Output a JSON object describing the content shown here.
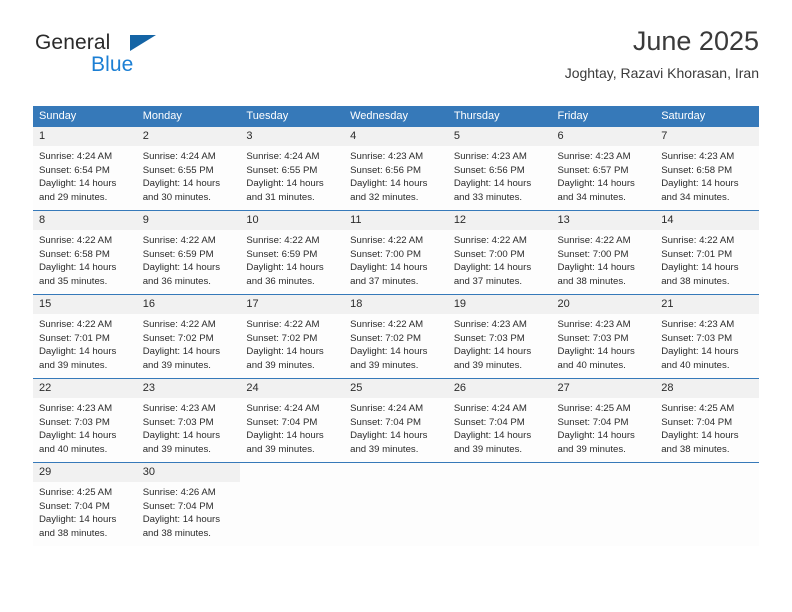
{
  "brand": {
    "word_one": "General",
    "word_two": "Blue",
    "triangle_icon": "brand-triangle-icon"
  },
  "header": {
    "title": "June 2025",
    "subtitle": "Joghtay, Razavi Khorasan, Iran"
  },
  "colors": {
    "header_blue": "#3679b9",
    "brand_blue": "#1c7fd4",
    "triangle_blue": "#1464a5",
    "daynum_band": "#f1f1f1",
    "text": "#2b2b2b"
  },
  "calendar": {
    "weekday_headers": [
      "Sunday",
      "Monday",
      "Tuesday",
      "Wednesday",
      "Thursday",
      "Friday",
      "Saturday"
    ],
    "weeks": [
      [
        {
          "day": "1",
          "sunrise": "Sunrise: 4:24 AM",
          "sunset": "Sunset: 6:54 PM",
          "daylight": "Daylight: 14 hours and 29 minutes."
        },
        {
          "day": "2",
          "sunrise": "Sunrise: 4:24 AM",
          "sunset": "Sunset: 6:55 PM",
          "daylight": "Daylight: 14 hours and 30 minutes."
        },
        {
          "day": "3",
          "sunrise": "Sunrise: 4:24 AM",
          "sunset": "Sunset: 6:55 PM",
          "daylight": "Daylight: 14 hours and 31 minutes."
        },
        {
          "day": "4",
          "sunrise": "Sunrise: 4:23 AM",
          "sunset": "Sunset: 6:56 PM",
          "daylight": "Daylight: 14 hours and 32 minutes."
        },
        {
          "day": "5",
          "sunrise": "Sunrise: 4:23 AM",
          "sunset": "Sunset: 6:56 PM",
          "daylight": "Daylight: 14 hours and 33 minutes."
        },
        {
          "day": "6",
          "sunrise": "Sunrise: 4:23 AM",
          "sunset": "Sunset: 6:57 PM",
          "daylight": "Daylight: 14 hours and 34 minutes."
        },
        {
          "day": "7",
          "sunrise": "Sunrise: 4:23 AM",
          "sunset": "Sunset: 6:58 PM",
          "daylight": "Daylight: 14 hours and 34 minutes."
        }
      ],
      [
        {
          "day": "8",
          "sunrise": "Sunrise: 4:22 AM",
          "sunset": "Sunset: 6:58 PM",
          "daylight": "Daylight: 14 hours and 35 minutes."
        },
        {
          "day": "9",
          "sunrise": "Sunrise: 4:22 AM",
          "sunset": "Sunset: 6:59 PM",
          "daylight": "Daylight: 14 hours and 36 minutes."
        },
        {
          "day": "10",
          "sunrise": "Sunrise: 4:22 AM",
          "sunset": "Sunset: 6:59 PM",
          "daylight": "Daylight: 14 hours and 36 minutes."
        },
        {
          "day": "11",
          "sunrise": "Sunrise: 4:22 AM",
          "sunset": "Sunset: 7:00 PM",
          "daylight": "Daylight: 14 hours and 37 minutes."
        },
        {
          "day": "12",
          "sunrise": "Sunrise: 4:22 AM",
          "sunset": "Sunset: 7:00 PM",
          "daylight": "Daylight: 14 hours and 37 minutes."
        },
        {
          "day": "13",
          "sunrise": "Sunrise: 4:22 AM",
          "sunset": "Sunset: 7:00 PM",
          "daylight": "Daylight: 14 hours and 38 minutes."
        },
        {
          "day": "14",
          "sunrise": "Sunrise: 4:22 AM",
          "sunset": "Sunset: 7:01 PM",
          "daylight": "Daylight: 14 hours and 38 minutes."
        }
      ],
      [
        {
          "day": "15",
          "sunrise": "Sunrise: 4:22 AM",
          "sunset": "Sunset: 7:01 PM",
          "daylight": "Daylight: 14 hours and 39 minutes."
        },
        {
          "day": "16",
          "sunrise": "Sunrise: 4:22 AM",
          "sunset": "Sunset: 7:02 PM",
          "daylight": "Daylight: 14 hours and 39 minutes."
        },
        {
          "day": "17",
          "sunrise": "Sunrise: 4:22 AM",
          "sunset": "Sunset: 7:02 PM",
          "daylight": "Daylight: 14 hours and 39 minutes."
        },
        {
          "day": "18",
          "sunrise": "Sunrise: 4:22 AM",
          "sunset": "Sunset: 7:02 PM",
          "daylight": "Daylight: 14 hours and 39 minutes."
        },
        {
          "day": "19",
          "sunrise": "Sunrise: 4:23 AM",
          "sunset": "Sunset: 7:03 PM",
          "daylight": "Daylight: 14 hours and 39 minutes."
        },
        {
          "day": "20",
          "sunrise": "Sunrise: 4:23 AM",
          "sunset": "Sunset: 7:03 PM",
          "daylight": "Daylight: 14 hours and 40 minutes."
        },
        {
          "day": "21",
          "sunrise": "Sunrise: 4:23 AM",
          "sunset": "Sunset: 7:03 PM",
          "daylight": "Daylight: 14 hours and 40 minutes."
        }
      ],
      [
        {
          "day": "22",
          "sunrise": "Sunrise: 4:23 AM",
          "sunset": "Sunset: 7:03 PM",
          "daylight": "Daylight: 14 hours and 40 minutes."
        },
        {
          "day": "23",
          "sunrise": "Sunrise: 4:23 AM",
          "sunset": "Sunset: 7:03 PM",
          "daylight": "Daylight: 14 hours and 39 minutes."
        },
        {
          "day": "24",
          "sunrise": "Sunrise: 4:24 AM",
          "sunset": "Sunset: 7:04 PM",
          "daylight": "Daylight: 14 hours and 39 minutes."
        },
        {
          "day": "25",
          "sunrise": "Sunrise: 4:24 AM",
          "sunset": "Sunset: 7:04 PM",
          "daylight": "Daylight: 14 hours and 39 minutes."
        },
        {
          "day": "26",
          "sunrise": "Sunrise: 4:24 AM",
          "sunset": "Sunset: 7:04 PM",
          "daylight": "Daylight: 14 hours and 39 minutes."
        },
        {
          "day": "27",
          "sunrise": "Sunrise: 4:25 AM",
          "sunset": "Sunset: 7:04 PM",
          "daylight": "Daylight: 14 hours and 39 minutes."
        },
        {
          "day": "28",
          "sunrise": "Sunrise: 4:25 AM",
          "sunset": "Sunset: 7:04 PM",
          "daylight": "Daylight: 14 hours and 38 minutes."
        }
      ],
      [
        {
          "day": "29",
          "sunrise": "Sunrise: 4:25 AM",
          "sunset": "Sunset: 7:04 PM",
          "daylight": "Daylight: 14 hours and 38 minutes."
        },
        {
          "day": "30",
          "sunrise": "Sunrise: 4:26 AM",
          "sunset": "Sunset: 7:04 PM",
          "daylight": "Daylight: 14 hours and 38 minutes."
        },
        {
          "day": "",
          "sunrise": "",
          "sunset": "",
          "daylight": ""
        },
        {
          "day": "",
          "sunrise": "",
          "sunset": "",
          "daylight": ""
        },
        {
          "day": "",
          "sunrise": "",
          "sunset": "",
          "daylight": ""
        },
        {
          "day": "",
          "sunrise": "",
          "sunset": "",
          "daylight": ""
        },
        {
          "day": "",
          "sunrise": "",
          "sunset": "",
          "daylight": ""
        }
      ]
    ]
  }
}
